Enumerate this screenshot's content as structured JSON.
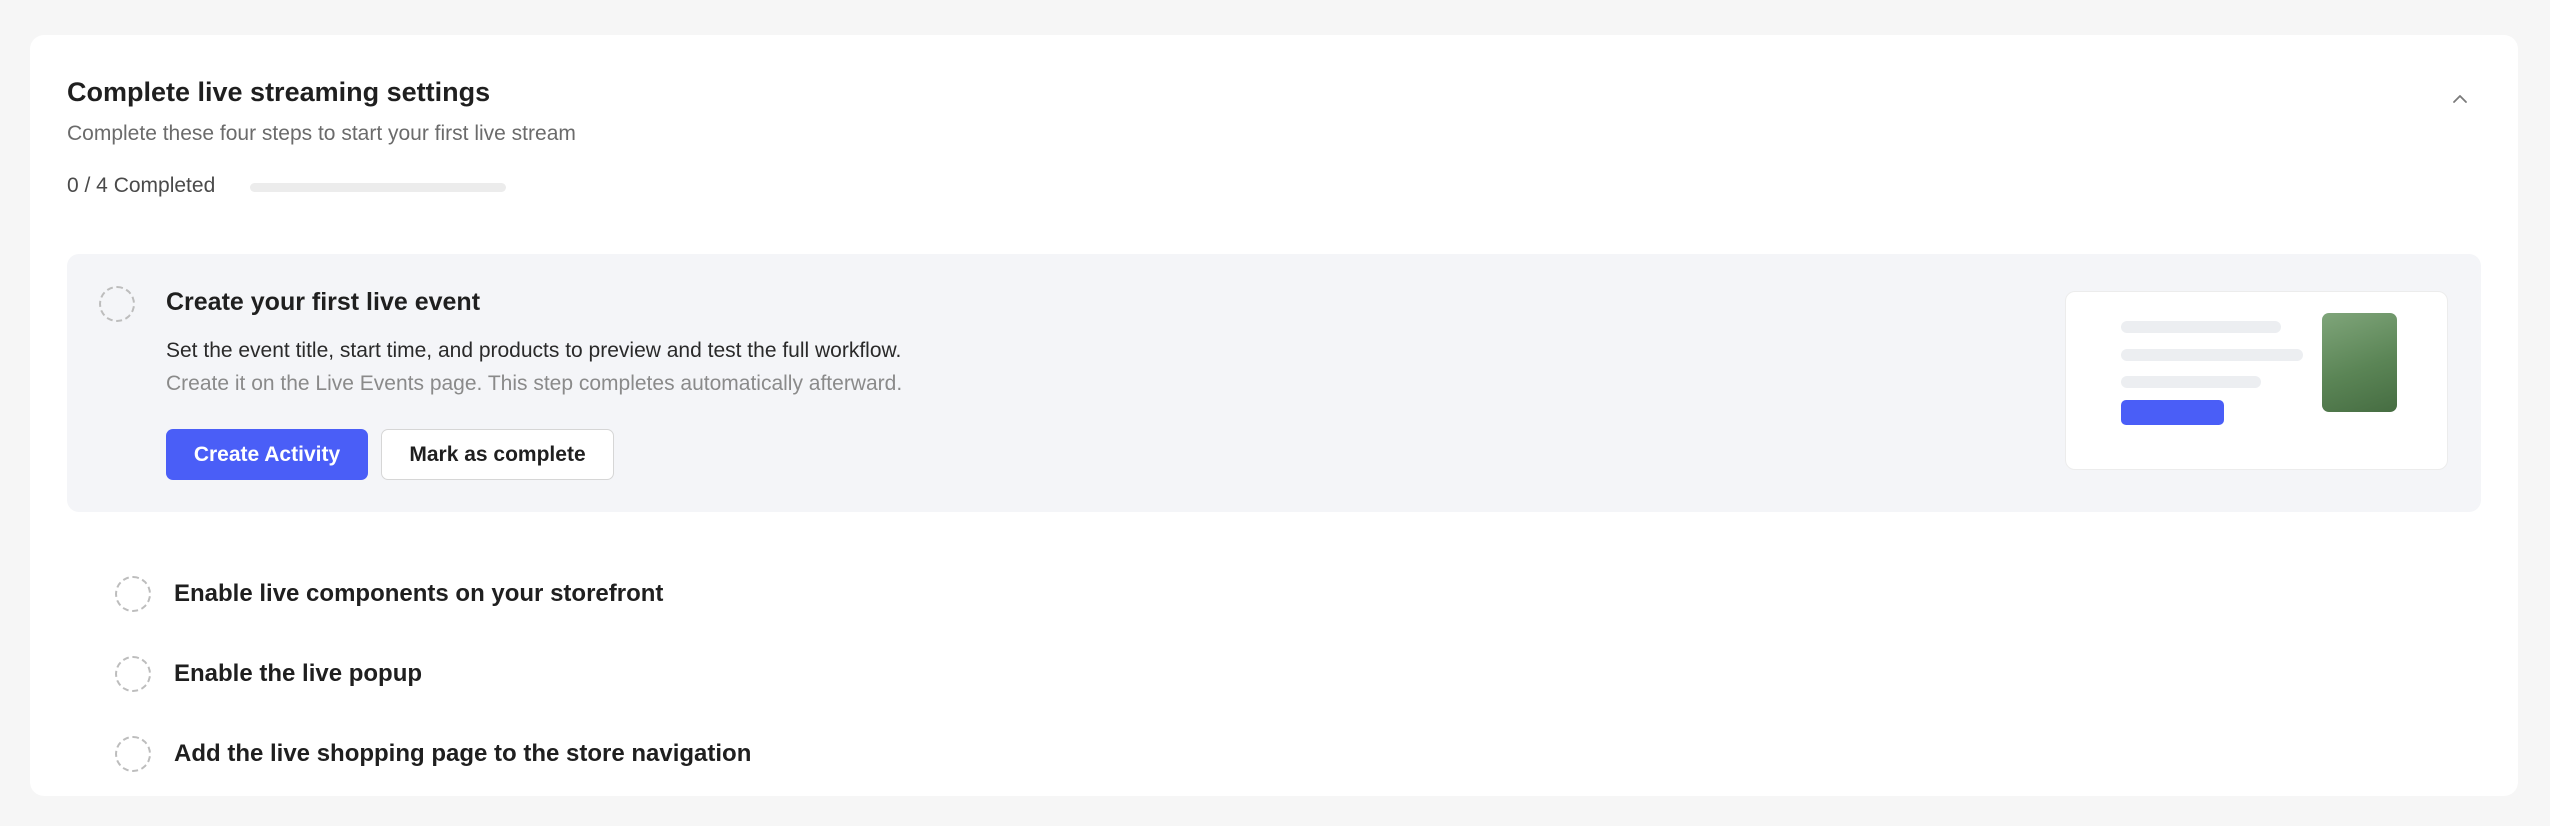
{
  "header": {
    "title": "Complete live streaming settings",
    "subtitle": "Complete these four steps to start your first live stream",
    "progress_text": "0 / 4 Completed",
    "progress": {
      "completed": 0,
      "total": 4
    },
    "collapse_icon": "chevron-up-icon"
  },
  "steps": [
    {
      "title": "Create your first live event",
      "description": "Set the event title, start time, and products to preview and test the full workflow.",
      "hint": "Create it on the Live Events page. This step completes automatically afterward.",
      "primary_button": "Create Activity",
      "secondary_button": "Mark as complete",
      "expanded": true,
      "completed": false
    },
    {
      "title": "Enable live components on your storefront",
      "completed": false
    },
    {
      "title": "Enable the live popup",
      "completed": false
    },
    {
      "title": "Add the live shopping page to the store navigation",
      "completed": false
    }
  ],
  "colors": {
    "accent": "#4a5ef7",
    "card_background": "#ffffff",
    "page_background": "#f6f6f6",
    "active_step_background": "#f4f5f8"
  }
}
